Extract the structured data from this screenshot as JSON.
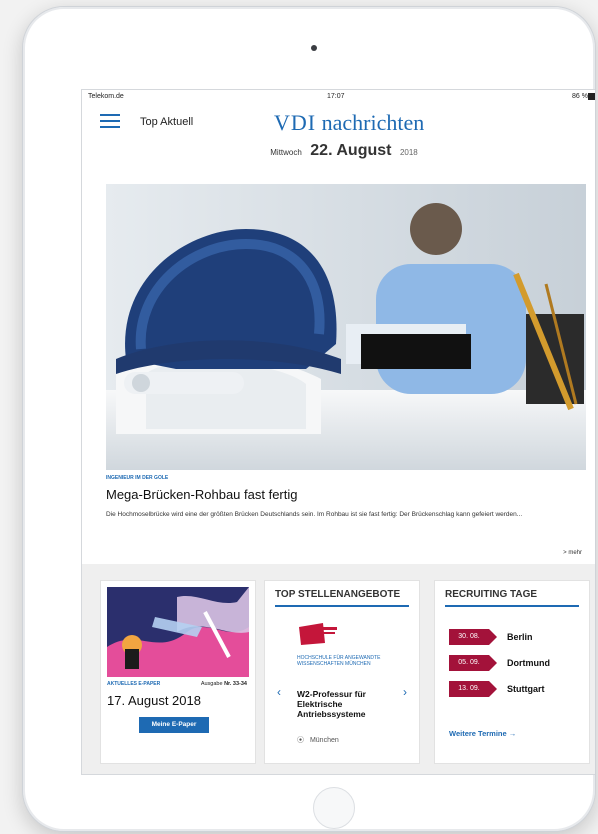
{
  "status": {
    "carrier": "Telekom.de",
    "time": "17:07",
    "battery": "86 %"
  },
  "header": {
    "menu_label": "Top Aktuell",
    "logo_prefix": "VDI",
    "logo_suffix": "nachrichten"
  },
  "dateline": {
    "weekday": "Mittwoch",
    "day_month": "22. August",
    "year": "2018"
  },
  "lead_article": {
    "kicker": "INGENIEUR IM DER GOLE",
    "headline": "Mega-Brücken-Rohbau fast fertig",
    "teaser": "Die Hochmoselbrücke wird eine der größten Brücken Deutschlands sein. Im Rohbau ist sie fast fertig: Der Brückenschlag kann gefeiert werden...",
    "more": "> mehr"
  },
  "epaper": {
    "kicker": "AKTUELLES E-PAPER",
    "issue_label": "Ausgabe",
    "issue_number": "Nr. 33-34",
    "date": "17. August 2018",
    "button": "Meine E-Paper"
  },
  "jobs": {
    "title": "TOP STELLENANGEBOTE",
    "employer": "HOCHSCHULE FÜR ANGEWANDTE WISSENSCHAFTEN MÜNCHEN",
    "job_title": "W2-Professur für Elektrische Antriebssysteme",
    "location": "München"
  },
  "recruiting": {
    "title": "RECRUITING TAGE",
    "events": [
      {
        "date": "30. 08.",
        "city": "Berlin"
      },
      {
        "date": "05. 09.",
        "city": "Dortmund"
      },
      {
        "date": "13. 09.",
        "city": "Stuttgart"
      }
    ],
    "more_link": "Weitere Termine →"
  },
  "colors": {
    "brand_blue": "#1e6ab3",
    "event_red": "#a3123a"
  }
}
